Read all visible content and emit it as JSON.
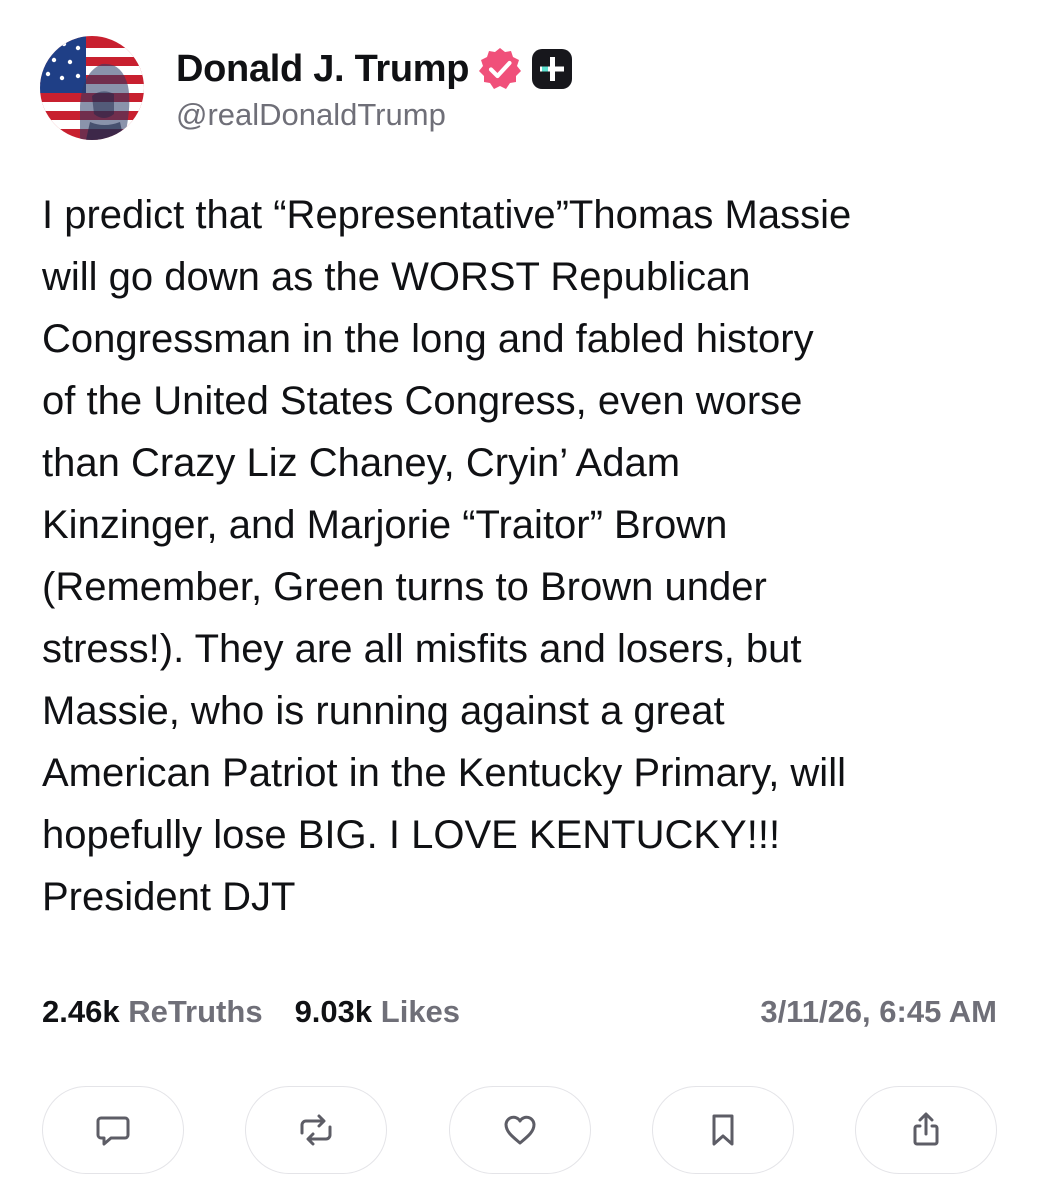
{
  "author": {
    "display_name": "Donald J. Trump",
    "handle": "@realDonaldTrump",
    "verified_color": "#f0507a",
    "badge_color": "#17171c",
    "badge_accent": "#5ee0d0"
  },
  "post": {
    "text": "I predict that “Representative”Thomas Massie\nwill go down as the WORST Republican\nCongressman in the long and fabled history\nof the United States Congress, even worse\nthan Crazy Liz Chaney, Cryin’ Adam\nKinzinger, and Marjorie “Traitor” Brown\n(Remember, Green turns to Brown under\nstress!). They are all misfits and losers, but\nMassie, who is running against a great\nAmerican Patriot in the Kentucky Primary, will\nhopefully lose BIG. I LOVE KENTUCKY!!!\nPresident DJT"
  },
  "stats": {
    "retruths_count": "2.46k",
    "retruths_label": "ReTruths",
    "likes_count": "9.03k",
    "likes_label": "Likes",
    "timestamp": "3/11/26, 6:45 AM"
  },
  "actions": [
    {
      "icon": "comment-icon"
    },
    {
      "icon": "retruth-icon"
    },
    {
      "icon": "heart-icon"
    },
    {
      "icon": "bookmark-icon"
    },
    {
      "icon": "share-icon"
    }
  ]
}
